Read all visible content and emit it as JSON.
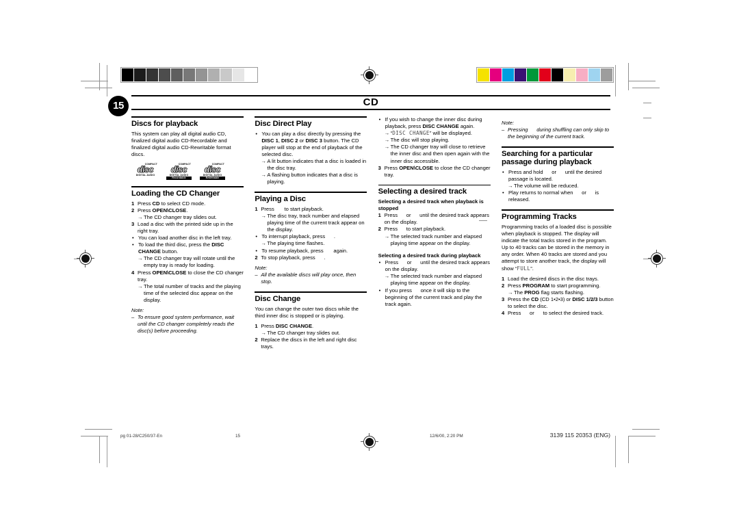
{
  "document": {
    "header": {
      "page_number": "15",
      "title": "CD"
    },
    "footer": {
      "file": "pg 01-28/C250/37-En",
      "page": "15",
      "timestamp": "12/6/00, 2:20 PM",
      "code": "3139 115 20353 (ENG)"
    },
    "calibration": {
      "grayscale": [
        "#000000",
        "#1c1c1c",
        "#343434",
        "#4d4d4d",
        "#5f5f5f",
        "#787878",
        "#949494",
        "#b0b0b0",
        "#c9c9c9",
        "#e6e6e6",
        "#ffffff"
      ],
      "colors": [
        "#f5e200",
        "#e5007e",
        "#009ee0",
        "#3a1273",
        "#00983a",
        "#e2001a",
        "#000000",
        "#f7eeb0",
        "#f7aec4",
        "#9fd4f0",
        "#9d9d9d"
      ]
    }
  },
  "columns": [
    {
      "sections": [
        {
          "heading": "Discs for playback",
          "body": "This system can play all digital audio CD, finalized digital audio CD-Recordable and finalized digital audio CD-Rewritable format discs.",
          "logos": [
            {
              "top": "COMPACT",
              "mid": "disc",
              "bottom": "DIGITAL AUDIO",
              "tag": ""
            },
            {
              "top": "COMPACT",
              "mid": "disc",
              "bottom": "DIGITAL AUDIO",
              "tag": "Recordable"
            },
            {
              "top": "COMPACT",
              "mid": "disc",
              "bottom": "DIGITAL AUDIO",
              "tag": "ReWritable"
            }
          ]
        },
        {
          "heading": "Loading the CD Changer",
          "steps": [
            {
              "mark": "1",
              "text": "Press <b>CD</b> to select CD mode."
            },
            {
              "mark": "2",
              "text": "Press <b>OPEN\\CLOSE</b>."
            },
            {
              "mark": "→",
              "text": "The CD changer tray slides out.",
              "arrow": true
            },
            {
              "mark": "3",
              "text": "Load a disc with the printed side up in the right tray."
            },
            {
              "mark": "•",
              "text": "You can load another disc in the left tray."
            },
            {
              "mark": "•",
              "text": "To load the third disc, press the <b>DISC CHANGE</b> button."
            },
            {
              "mark": "→",
              "text": "The CD changer tray will rotate until the empty tray is ready for loading.",
              "arrow": true
            },
            {
              "mark": "4",
              "text": "Press <b>OPEN\\CLOSE</b> to close the CD changer tray."
            },
            {
              "mark": "→",
              "text": "The total number of tracks and the playing time of the selected disc appear on the display.",
              "arrow": true
            }
          ],
          "note_label": "Note:",
          "note": "To ensure good system performance, wait until the CD changer completely reads the disc(s) before proceeding."
        }
      ]
    },
    {
      "sections": [
        {
          "heading": "Disc Direct Play",
          "steps": [
            {
              "mark": "•",
              "text": "You can play a disc directly by pressing the <b>DISC 1</b>, <b>DISC 2</b> or <b>DISC 3</b> button. The CD player will stop at the end of playback of the selected disc."
            },
            {
              "mark": "→",
              "text": "A lit button indicates that a disc is loaded in the disc tray.",
              "arrow": true
            },
            {
              "mark": "→",
              "text": "A flashing button indicates that a disc is playing.",
              "arrow": true
            }
          ]
        },
        {
          "heading": "Playing a Disc",
          "steps": [
            {
              "mark": "1",
              "text": "Press&nbsp;&nbsp;&nbsp;&nbsp;&nbsp;&nbsp; to start playback."
            },
            {
              "mark": "→",
              "text": "The disc tray, track number and elapsed playing time of the current track appear on the display.",
              "arrow": true
            },
            {
              "mark": "•",
              "text": "To interrupt playback, press&nbsp;&nbsp;&nbsp;&nbsp;&nbsp;&nbsp;."
            },
            {
              "mark": "→",
              "text": "The playing time flashes.",
              "arrow": true
            },
            {
              "mark": "•",
              "text": "To resume playback, press&nbsp;&nbsp;&nbsp;&nbsp;&nbsp;&nbsp; again."
            },
            {
              "mark": "2",
              "text": "To stop playback, press&nbsp;&nbsp;&nbsp;&nbsp;&nbsp;&nbsp;."
            }
          ],
          "note_label": "Note:",
          "note": "All the available discs will play once, then stop."
        },
        {
          "heading": "Disc Change",
          "body": "You can change the outer two discs while the third inner disc is stopped or is playing.",
          "steps": [
            {
              "mark": "1",
              "text": "Press <b>DISC CHANGE</b>."
            },
            {
              "mark": "→",
              "text": "The CD changer tray slides out.",
              "arrow": true
            },
            {
              "mark": "2",
              "text": "Replace the discs in the left and right disc trays."
            }
          ]
        }
      ]
    },
    {
      "sections": [
        {
          "heading": "",
          "steps": [
            {
              "mark": "•",
              "text": "If you wish to change the inner disc during playback, press <b>DISC CHANGE</b> again."
            },
            {
              "mark": "→",
              "text": "“<span class=\"lcd\">DISC CHANGE</span>” will be displayed.",
              "arrow": true
            },
            {
              "mark": "→",
              "text": "The disc will stop playing.",
              "arrow": true
            },
            {
              "mark": "→",
              "text": "The CD changer tray will close to retrieve the inner disc and then open again with the inner disc accessible.",
              "arrow": true
            },
            {
              "mark": "3",
              "text": "Press <b>OPEN\\CLOSE</b> to close the CD changer tray."
            }
          ]
        },
        {
          "heading": "Selecting a desired track",
          "subsections": [
            {
              "subheading": "Selecting a desired track when playback is stopped",
              "steps": [
                {
                  "mark": "1",
                  "text": "Press&nbsp;&nbsp;&nbsp;&nbsp;&nbsp; or&nbsp;&nbsp;&nbsp;&nbsp;&nbsp; until the desired track appears on the display."
                },
                {
                  "mark": "2",
                  "text": "Press&nbsp;&nbsp;&nbsp;&nbsp;&nbsp; to start playback."
                },
                {
                  "mark": "→",
                  "text": "The selected track number and elapsed playing time appear on the display.",
                  "arrow": true
                }
              ]
            },
            {
              "subheading": "Selecting a desired track during playback",
              "steps": [
                {
                  "mark": "•",
                  "text": "Press&nbsp;&nbsp;&nbsp;&nbsp;&nbsp; or&nbsp;&nbsp;&nbsp;&nbsp;&nbsp; until the desired track appears on the display."
                },
                {
                  "mark": "→",
                  "text": "The selected track number and elapsed playing time appear on the display.",
                  "arrow": true
                },
                {
                  "mark": "•",
                  "text": "If you press&nbsp;&nbsp;&nbsp;&nbsp;&nbsp; once it will skip to the beginning of the current track and play the track again."
                }
              ]
            }
          ]
        }
      ]
    },
    {
      "sections": [
        {
          "heading": "",
          "note_label": "Note:",
          "note": "Pressing&nbsp;&nbsp;&nbsp;&nbsp;&nbsp; during shuffling can only skip to the beginning of the current track."
        },
        {
          "heading": "Searching for a particular passage during playback",
          "steps": [
            {
              "mark": "•",
              "text": "Press and hold&nbsp;&nbsp;&nbsp;&nbsp;&nbsp; or&nbsp;&nbsp;&nbsp;&nbsp;&nbsp; until the desired passage is located."
            },
            {
              "mark": "→",
              "text": "The volume will be reduced.",
              "arrow": true
            },
            {
              "mark": "•",
              "text": "Play returns to normal when&nbsp;&nbsp;&nbsp;&nbsp;&nbsp; or&nbsp;&nbsp;&nbsp;&nbsp;&nbsp; is released."
            }
          ]
        },
        {
          "heading": "Programming Tracks",
          "body": "Programming tracks of a loaded disc is possible when playback is stopped. The display will indicate the total tracks stored in the program. Up to 40 tracks can be stored in the memory in any order. When 40 tracks are stored and you attempt to store another track, the display will show “<span class=\"lcd\">FULL</span>”.",
          "steps": [
            {
              "mark": "1",
              "text": "Load the desired discs in the disc trays."
            },
            {
              "mark": "2",
              "text": "Press <b>PROGRAM</b> to start programming."
            },
            {
              "mark": "→",
              "text": "The <b>PROG</b> flag starts flashing.",
              "arrow": true
            },
            {
              "mark": "3",
              "text": "Press the <b>CD</b> (CD 1•2•3) or <b>DISC 1/2/3</b> button to select the disc."
            },
            {
              "mark": "4",
              "text": "Press&nbsp;&nbsp;&nbsp;&nbsp;&nbsp; or&nbsp;&nbsp;&nbsp;&nbsp;&nbsp; to select the desired track."
            }
          ]
        }
      ]
    }
  ]
}
